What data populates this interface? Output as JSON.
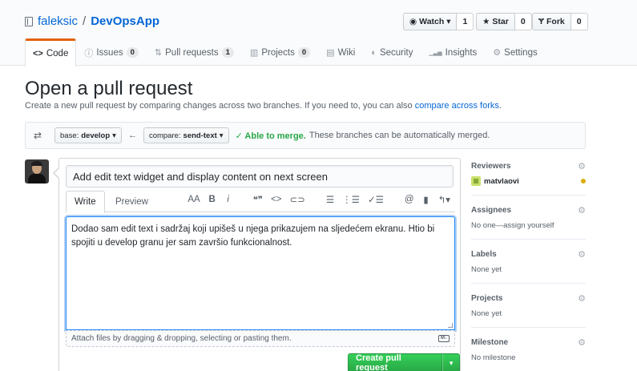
{
  "repo": {
    "owner": "faleksic",
    "separator": "/",
    "name": "DevOpsApp"
  },
  "actions": [
    {
      "label": "Watch ▾",
      "icon": "eye-icon",
      "count": "1",
      "id": "watch"
    },
    {
      "label": "Star",
      "icon": "star-icon",
      "count": "0",
      "id": "star"
    },
    {
      "label": "Fork",
      "icon": "fork-icon",
      "count": "0",
      "id": "fork"
    }
  ],
  "nav": {
    "code": {
      "label": "Code",
      "icon": "<>"
    },
    "issues": {
      "label": "Issues",
      "icon": "ⓘ",
      "count": "0"
    },
    "pulls": {
      "label": "Pull requests",
      "icon": "⇅",
      "count": "1"
    },
    "projects": {
      "label": "Projects",
      "icon": "▥",
      "count": "0"
    },
    "wiki": {
      "label": "Wiki",
      "icon": "▤"
    },
    "security": {
      "label": "Security",
      "icon": "◐"
    },
    "insights": {
      "label": "Insights",
      "icon": "▁▃▅"
    },
    "settings": {
      "label": "Settings",
      "icon": "⚙"
    }
  },
  "page": {
    "title": "Open a pull request",
    "subtitle": "Create a new pull request by comparing changes across two branches. If you need to, you can also",
    "subtitle_link": "compare across forks",
    "subtitle_end": "."
  },
  "range": {
    "base_prefix": "base:",
    "base": "develop",
    "compare_prefix": "compare:",
    "compare": "send-text",
    "merge_ok": "✓ Able to merge.",
    "merge_text": "These branches can be automatically merged."
  },
  "composer": {
    "title_value": "Add edit text widget and display content on next screen",
    "tab_write": "Write",
    "tab_preview": "Preview",
    "toolbar": [
      "AA",
      "B",
      "i",
      "❝❞",
      "<>",
      "⊂⊃",
      "☰",
      "⋮☰",
      "✓☰",
      "@",
      "▮",
      "↰▾"
    ],
    "body": "Dodao sam edit text i sadržaj koji upišeš u njega prikazujem na sljedećem ekranu. Htio bi spojiti u develop granu jer sam završio funkcionalnost.",
    "attach": "Attach files by dragging & dropping, selecting or pasting them.",
    "md_badge": "M↓",
    "create_label": "Create pull request",
    "create_drop": "▾"
  },
  "sidebar": {
    "reviewers": {
      "title": "Reviewers",
      "value": "matvlaovi"
    },
    "assignees": {
      "title": "Assignees",
      "value": "No one—assign yourself"
    },
    "labels": {
      "title": "Labels",
      "value": "None yet"
    },
    "projects": {
      "title": "Projects",
      "value": "None yet"
    },
    "milestone": {
      "title": "Milestone",
      "value": "No milestone"
    }
  },
  "colors": {
    "link": "#0366d6",
    "success": "#28a745",
    "accent": "#e36209",
    "pending": "#dbab09"
  }
}
